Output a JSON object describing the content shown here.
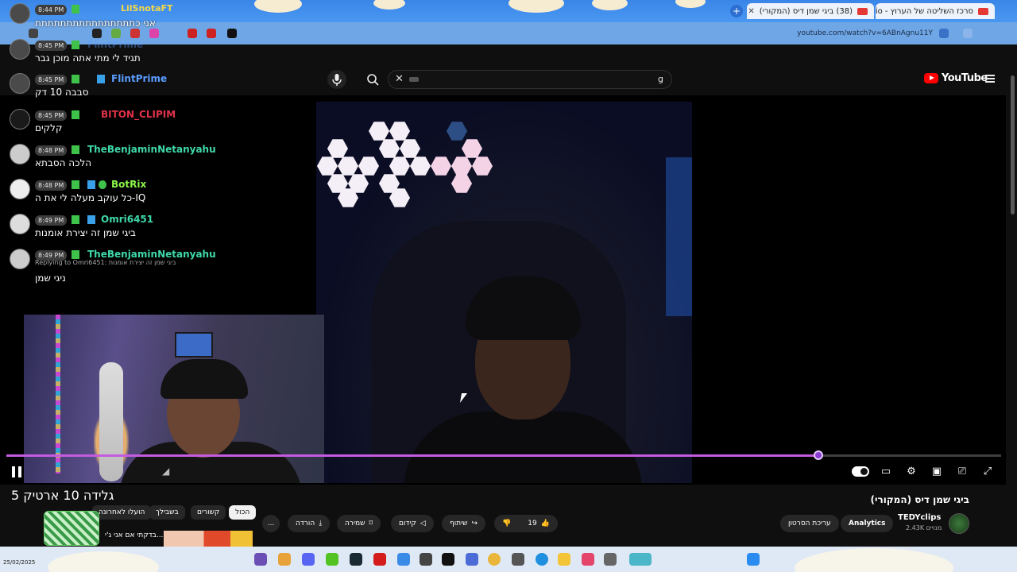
{
  "browser": {
    "tabs": [
      {
        "label": "(38) ביגי שמן דיס (המקורי)"
      },
      {
        "label": "סרכז השליטה של הערוץ - dio"
      }
    ],
    "url": "youtube.com/watch?v=6ABnAgnu11Y"
  },
  "youtube": {
    "logo_text": "YouTube",
    "search_query": "g"
  },
  "chat": {
    "pinned": {
      "time": "8:44 PM",
      "user": "LilSnotaFT",
      "text": "אני כתתתתתתתתתתתתתתתת"
    },
    "messages": [
      {
        "time": "8:45 PM",
        "user": "FlintPrime",
        "text": "תגיד לי מתי אתה מוכן גבר",
        "color": "#5b9cff"
      },
      {
        "time": "8:45 PM",
        "user": "FlintPrime",
        "text": "סבבה 10 דק",
        "color": "#5b9cff"
      },
      {
        "time": "8:45 PM",
        "user": "BITON_CLIPIM",
        "text": "קלקים",
        "color": "#e0324a"
      },
      {
        "time": "8:48 PM",
        "user": "TheBenjaminNetanyahu",
        "text": "הלכה הסבתא",
        "color": "#3fd8a8"
      },
      {
        "time": "8:48 PM",
        "user": "BotRix",
        "text": "כל עוקב מעלה לי את ה-IQ",
        "color": "#8cf54a"
      },
      {
        "time": "8:49 PM",
        "user": "Omri6451",
        "text": "ביגי שמן זה יצירת אומנות",
        "color": "#3fd8a8"
      },
      {
        "time": "8:49 PM",
        "user": "TheBenjaminNetanyahu",
        "text": "ניגי שמן",
        "reply": "Replying to Omri6451: ביגי שמן זה יצירת אומנות",
        "color": "#3fd8a8"
      }
    ]
  },
  "video": {
    "title": "ביגי שמן דיס (המקורי)",
    "overlay_title": "גלידה 10 ארטיק 5",
    "progress_percent": 81.6,
    "channel": {
      "name": "TEDYclips",
      "subs": "2.43K מנויים"
    },
    "buttons": {
      "analytics": "Analytics",
      "edit": "עריכת הסרטון",
      "likes": "19",
      "share": "שיתוף",
      "promote": "קידום",
      "save": "שמירה",
      "download": "הורדה",
      "more": "..."
    }
  },
  "related_chips": [
    "הכול",
    "קשורים",
    "בשבילך",
    "הועלו לאחרונה"
  ],
  "related": {
    "first_title": "בדקתי אם אני ג'י..."
  },
  "taskbar": {
    "date": "25/02/2025"
  }
}
